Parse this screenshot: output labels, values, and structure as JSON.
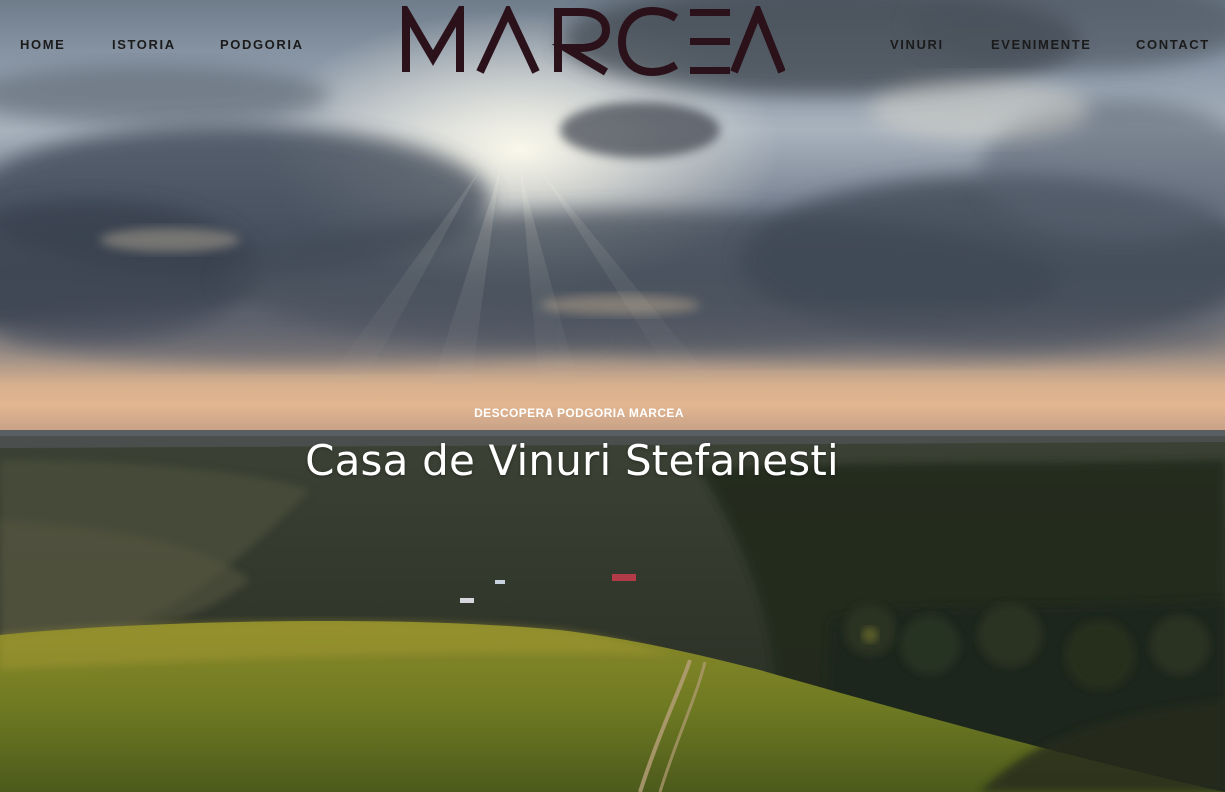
{
  "nav": {
    "left": [
      {
        "label": "HOME"
      },
      {
        "label": "ISTORIA"
      },
      {
        "label": "PODGORIA"
      }
    ],
    "right": [
      {
        "label": "VINURI"
      },
      {
        "label": "EVENIMENTE"
      },
      {
        "label": "CONTACT"
      }
    ]
  },
  "logo": {
    "text": "MARCEA",
    "color": "#2b1119"
  },
  "hero": {
    "eyebrow": "DESCOPERA PODGORIA MARCEA",
    "headline": "Casa de Vinuri Stefanesti"
  },
  "colors": {
    "nav_text": "#1b1b1b",
    "hero_text": "#ffffff",
    "logo": "#2b1119"
  }
}
